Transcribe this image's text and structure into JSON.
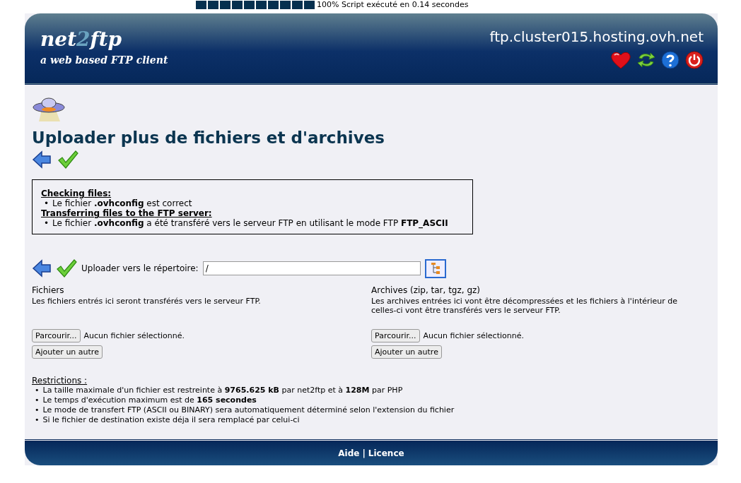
{
  "status": {
    "level": 1,
    "text": "100% Script exécuté en 0.14 secondes"
  },
  "header": {
    "logo": [
      "net",
      "2",
      "ftp"
    ],
    "tagline": "a web based FTP client",
    "server": "ftp.cluster015.hosting.ovh.net"
  },
  "bullet": "•",
  "page_title": "Uploader plus de fichiers et d'archives",
  "messages": [
    {
      "heading": "Checking files:",
      "items": [
        "Le fichier **.ovhconfig** est correct"
      ]
    },
    {
      "heading": "Transferring files to the FTP server:",
      "items": [
        "Le fichier **.ovhconfig** a été transféré vers le serveur FTP en utilisant le mode FTP **FTP_ASCII**"
      ]
    }
  ],
  "upload": {
    "label": "Uploader vers le répertoire:",
    "directory": "/"
  },
  "columns": [
    {
      "title": "Fichiers",
      "description": "Les fichiers entrés ici seront transférés vers le serveur FTP.",
      "browse_button": "Parcourir...",
      "file_status": "Aucun fichier sélectionné.",
      "add_button": "Ajouter un autre"
    },
    {
      "title": "Archives (zip, tar, tgz, gz)",
      "description": "Les archives entrées ici vont être décompressées et les fichiers à l'intérieur de celles-ci vont être transférés vers le serveur FTP.",
      "browse_button": "Parcourir...",
      "file_status": "Aucun fichier sélectionné.",
      "add_button": "Ajouter un autre"
    }
  ],
  "restrictions": {
    "title": "Restrictions :",
    "items": [
      "La taille maximale d'un fichier est restreinte à **9765.625 kB** par net2ftp et à **128M** par PHP",
      "Le temps d'exécution maximum est de **165 secondes**",
      "Le mode de transfert FTP (ASCII ou BINARY) sera automatiquement déterminé selon l'extension du fichier",
      "Si le fichier de destination existe déja il sera remplacé par celui-ci"
    ]
  },
  "footer": {
    "links": [
      "Aide",
      "Licence"
    ],
    "separator": "|"
  }
}
